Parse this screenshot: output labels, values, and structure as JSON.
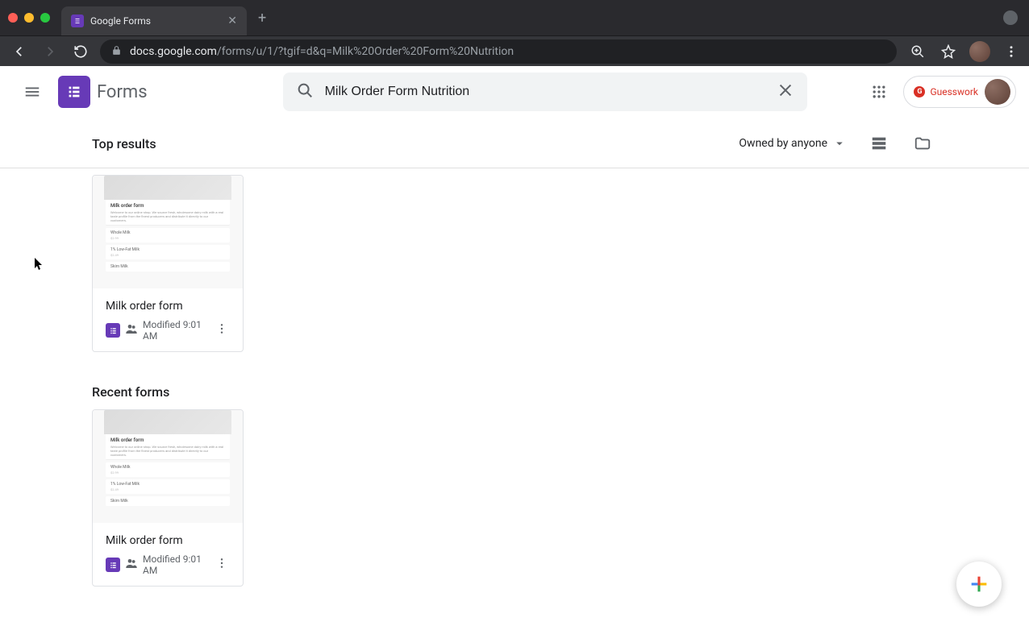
{
  "browser": {
    "tab_title": "Google Forms",
    "url_domain": "docs.google.com",
    "url_path": "/forms/u/1/?tgif=d&q=Milk%20Order%20Form%20Nutrition"
  },
  "header": {
    "product_name": "Forms",
    "search_value": "Milk Order Form Nutrition",
    "guesswork_label": "Guesswork"
  },
  "filter": {
    "top_results_label": "Top results",
    "owner_label": "Owned by anyone"
  },
  "sections": {
    "recent_label": "Recent forms"
  },
  "cards": {
    "top": [
      {
        "title": "Milk order form",
        "modified": "Modified 9:01 AM",
        "thumb_title": "Milk order form"
      }
    ],
    "recent": [
      {
        "title": "Milk order form",
        "modified": "Modified 9:01 AM",
        "thumb_title": "Milk order form"
      }
    ]
  }
}
